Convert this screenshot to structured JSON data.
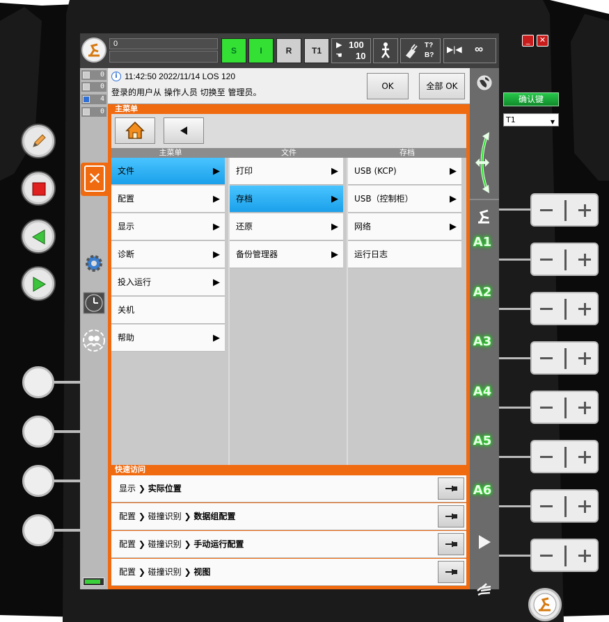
{
  "window_controls": {
    "minimize": "_",
    "close": "✕"
  },
  "confirm_button": "确认键",
  "mode_select": {
    "value": "T1"
  },
  "topbar": {
    "program_field_value": "0",
    "s_led": "S",
    "i_led": "I",
    "r_led": "R",
    "mode_badge": "T1",
    "override_prog": "100",
    "override_hand": "10",
    "tool_base": "T?\nB?",
    "incremental": "∞"
  },
  "message_counts": [
    "0",
    "0",
    "4",
    "0"
  ],
  "message": {
    "header": "11:42:50 2022/11/14 LOS 120",
    "text": "登录的用户从 操作人员 切换至 管理员。",
    "ok_label": "OK",
    "ok_all_label": "全部 OK"
  },
  "main_menu": {
    "title": "主菜单",
    "columns": [
      {
        "header": "主菜单",
        "items": [
          {
            "label": "文件",
            "has_submenu": true,
            "selected": true
          },
          {
            "label": "配置",
            "has_submenu": true,
            "selected": false
          },
          {
            "label": "显示",
            "has_submenu": true,
            "selected": false
          },
          {
            "label": "诊断",
            "has_submenu": true,
            "selected": false
          },
          {
            "label": "投入运行",
            "has_submenu": true,
            "selected": false
          },
          {
            "label": "关机",
            "has_submenu": false,
            "selected": false
          },
          {
            "label": "帮助",
            "has_submenu": true,
            "selected": false
          }
        ]
      },
      {
        "header": "文件",
        "items": [
          {
            "label": "打印",
            "has_submenu": true,
            "selected": false
          },
          {
            "label": "存档",
            "has_submenu": true,
            "selected": true
          },
          {
            "label": "还原",
            "has_submenu": true,
            "selected": false
          },
          {
            "label": "备份管理器",
            "has_submenu": true,
            "selected": false
          }
        ]
      },
      {
        "header": "存档",
        "items": [
          {
            "label": "USB (KCP)",
            "has_submenu": true,
            "selected": false
          },
          {
            "label": "USB（控制柜）",
            "has_submenu": true,
            "selected": false
          },
          {
            "label": "网络",
            "has_submenu": true,
            "selected": false
          },
          {
            "label": "运行日志",
            "has_submenu": false,
            "selected": false
          }
        ]
      }
    ]
  },
  "quick_access": {
    "title": "快速访问",
    "rows": [
      {
        "path": "显示 ❯ ",
        "target": "实际位置"
      },
      {
        "path": "配置 ❯ 碰撞识别 ❯ ",
        "target": "数据组配置"
      },
      {
        "path": "配置 ❯ 碰撞识别 ❯ ",
        "target": "手动运行配置"
      },
      {
        "path": "配置 ❯ 碰撞识别 ❯ ",
        "target": "视图"
      }
    ]
  },
  "axes": [
    "A1",
    "A2",
    "A3",
    "A4",
    "A5",
    "A6"
  ],
  "colors": {
    "accent_orange": "#f06a10",
    "selection_blue": "#1aa0ea",
    "led_green": "#34e034",
    "axis_glow": "#2be02b"
  }
}
